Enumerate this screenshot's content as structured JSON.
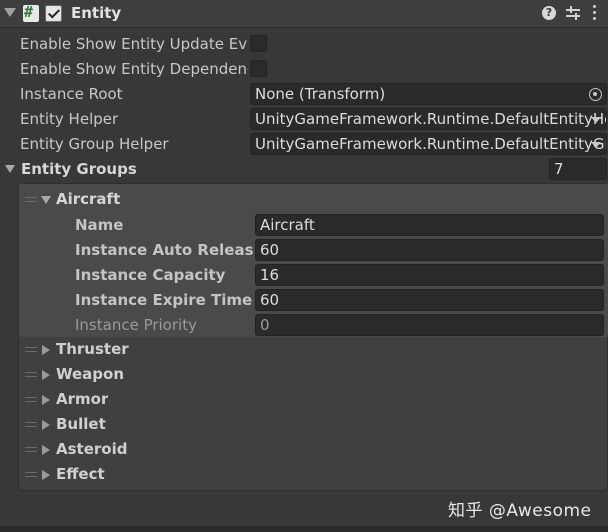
{
  "component": {
    "title": "Entity",
    "enabled": true,
    "script_icon": "#",
    "icons": [
      "help-icon",
      "preset-icon",
      "more-menu-icon"
    ]
  },
  "properties": {
    "show_update_event_label": "Enable Show Entity Update Eve",
    "show_update_event_checked": false,
    "show_dependency_label": "Enable Show Entity Dependency",
    "show_dependency_checked": false,
    "instance_root_label": "Instance Root",
    "instance_root_value": "None (Transform)",
    "entity_helper_label": "Entity Helper",
    "entity_helper_value": "UnityGameFramework.Runtime.DefaultEntityHe",
    "entity_group_helper_label": "Entity Group Helper",
    "entity_group_helper_value": "UnityGameFramework.Runtime.DefaultEntityGr"
  },
  "entity_groups": {
    "label": "Entity Groups",
    "count": "7",
    "expanded_group": {
      "title": "Aircraft",
      "name_label": "Name",
      "name_value": "Aircraft",
      "auto_release_label": "Instance Auto Release In",
      "auto_release_value": "60",
      "capacity_label": "Instance Capacity",
      "capacity_value": "16",
      "expire_label": "Instance Expire Time",
      "expire_value": "60",
      "priority_label": "Instance Priority",
      "priority_value": "0"
    },
    "collapsed_groups": [
      "Thruster",
      "Weapon",
      "Armor",
      "Bullet",
      "Asteroid",
      "Effect"
    ]
  },
  "watermark": "知乎 @Awesome"
}
